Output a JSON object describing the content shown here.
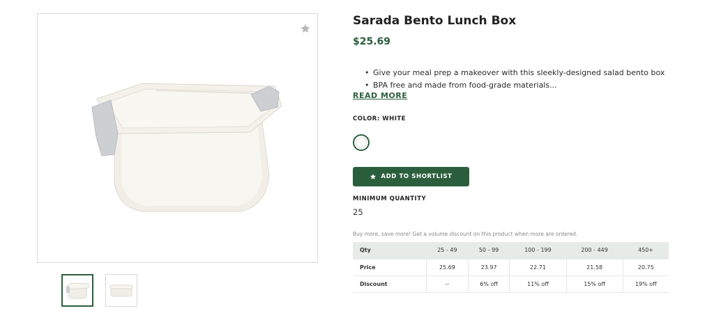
{
  "product": {
    "title": "Sarada Bento Lunch Box",
    "price": "$25.69",
    "bullets": [
      "Give your meal prep a makeover with this sleekly-designed salad bento box",
      "BPA free and made from food-grade materials..."
    ],
    "read_more_label": "READ MORE",
    "color_label": "COLOR: WHITE",
    "selected_color": "#fafaf7",
    "shortlist_label": "ADD TO SHORTLIST",
    "min_quantity_label": "MINIMUM QUANTITY",
    "min_quantity_value": "25",
    "volume_note": "Buy more, save more! Get a volume discount on this product when more are ordered."
  },
  "gallery": {
    "favorite_icon": "star-icon",
    "thumbnails": [
      "thumbnail-1",
      "thumbnail-2"
    ]
  },
  "pricing_table": {
    "header": [
      "Qty",
      "25 - 49",
      "50 - 99",
      "100 - 199",
      "200 - 449",
      "450+"
    ],
    "price_row": [
      "Price",
      "25.69",
      "23.97",
      "22.71",
      "21.58",
      "20.75"
    ],
    "discount_row": [
      "Discount",
      "--",
      "6% off",
      "11% off",
      "15% off",
      "19% off"
    ]
  },
  "colors": {
    "accent": "#2b5e3c",
    "table_header_bg": "#e6ebe8"
  }
}
